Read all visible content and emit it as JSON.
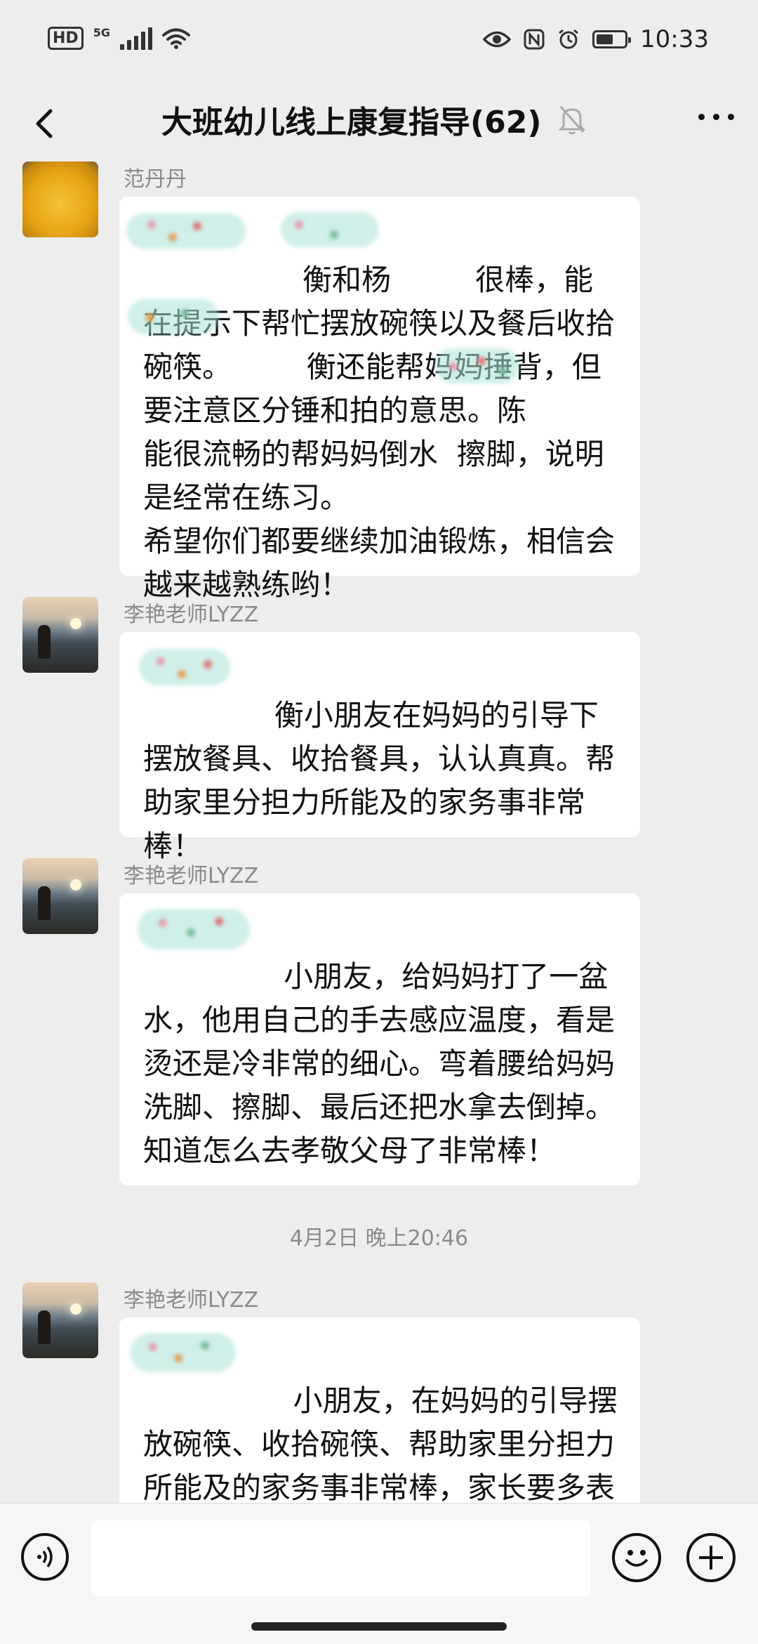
{
  "status_bar": {
    "hd_label": "HD",
    "network_label": "5G",
    "time": "10:33",
    "battery_level": 0.6
  },
  "header": {
    "back_icon": "chevron-left-icon",
    "title": "大班幼儿线上康复指导(62)",
    "mute_icon": "bell-off-icon",
    "more_icon": "more-dots-icon"
  },
  "messages": [
    {
      "sender": "范丹丹",
      "avatar": "mango-photo",
      "text": "           衡和杨         很棒，能在提示下帮忙摆放碗筷以及餐后收拾碗筷。        衡还能帮妈妈捶背，但要注意区分锤和拍的意思。陈         能很流畅的帮妈妈倒水  擦脚，说明是经常在练习。\n希望你们都要继续加油锻炼，相信会越来越熟练哟！"
    },
    {
      "sender": "李艳老师LYZZ",
      "avatar": "lake-photo",
      "text": "        衡小朋友在妈妈的引导下摆放餐具、收拾餐具，认认真真。帮助家里分担力所能及的家务事非常棒！"
    },
    {
      "sender": "李艳老师LYZZ",
      "avatar": "lake-photo",
      "text": "         小朋友，给妈妈打了一盆水，他用自己的手去感应温度，看是烫还是冷非常的细心。弯着腰给妈妈洗脚、擦脚、最后还把水拿去倒掉。知道怎么去孝敬父母了非常棒！"
    },
    {
      "sender": "李艳老师LYZZ",
      "avatar": "lake-photo",
      "text": "          小朋友，在妈妈的引导摆放碗筷、收拾碗筷、帮助家里分担力所能及的家务事非常棒，家长要多表扬哦这样我们的孩子们才更加愿"
    }
  ],
  "timestamp": "4月2日 晚上20:46",
  "input_bar": {
    "voice_icon": "voice-icon",
    "emoji_icon": "emoji-icon",
    "plus_icon": "plus-icon",
    "text_value": ""
  }
}
